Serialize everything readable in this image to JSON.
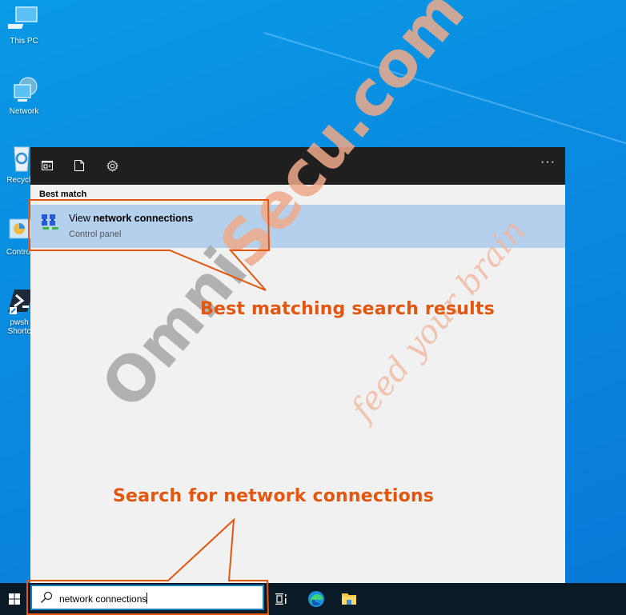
{
  "desktop": {
    "icons": [
      {
        "label": "This PC",
        "icon": "computer-icon"
      },
      {
        "label": "Network",
        "icon": "network-globe-icon"
      },
      {
        "label": "Recycle",
        "icon": "recycle-bin-icon"
      },
      {
        "label": "Control",
        "icon": "control-panel-icon"
      },
      {
        "label": "pwsh",
        "label2": "Shortc",
        "icon": "powershell-icon"
      }
    ]
  },
  "search_panel": {
    "toolbar": {
      "apps_icon": "apps-window-icon",
      "documents_icon": "document-icon",
      "settings_icon": "gear-icon",
      "more_label": "···"
    },
    "section_label": "Best match",
    "best_match": {
      "title_prefix": "View ",
      "title_bold": "network connections",
      "subtitle": "Control panel",
      "icon": "network-connections-icon"
    }
  },
  "taskbar": {
    "start_icon": "windows-logo-icon",
    "search": {
      "icon": "search-icon",
      "value": "network connections"
    },
    "pinned": [
      {
        "name": "task-view",
        "icon": "task-view-icon"
      },
      {
        "name": "edge",
        "icon": "edge-icon"
      },
      {
        "name": "file-explorer",
        "icon": "folder-icon"
      }
    ]
  },
  "annotations": {
    "callout_1": "Best matching search results",
    "callout_2": "Search for network connections",
    "accent_color": "#e2560f"
  },
  "watermark": {
    "brand_part1": "Omni",
    "brand_part2": "Secu.com",
    "tagline": "feed your brain"
  }
}
